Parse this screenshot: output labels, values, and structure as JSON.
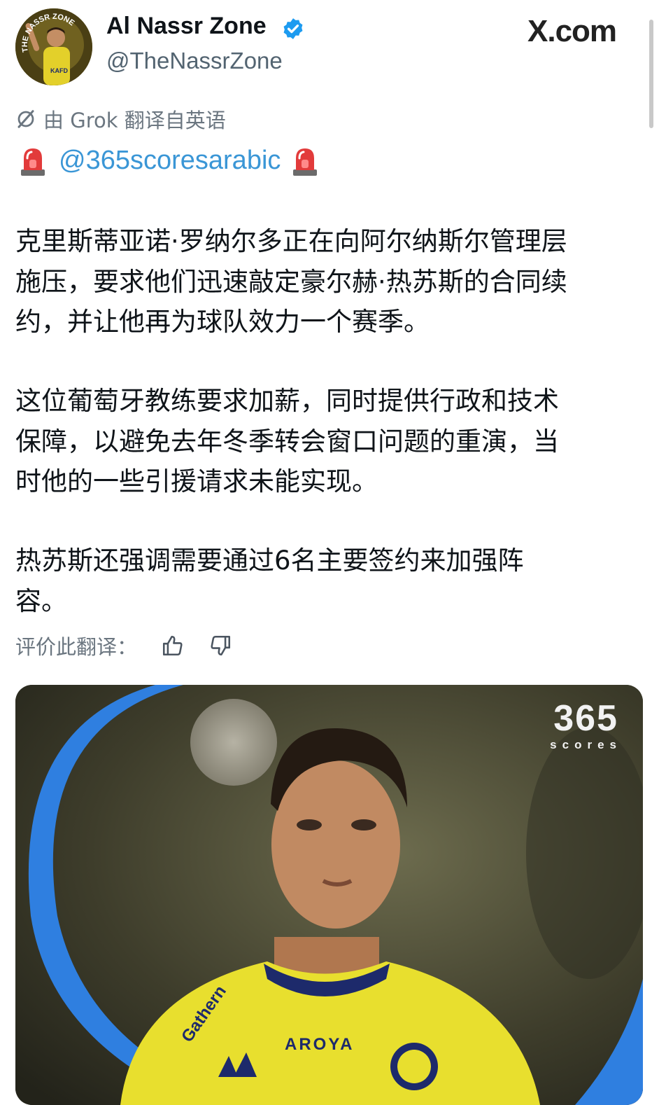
{
  "header": {
    "author_name": "Al Nassr Zone",
    "handle": "@TheNassrZone",
    "brand": "X.com",
    "verified": true
  },
  "avatar": {
    "text": "THE NASSR ZONE"
  },
  "translation_notice": "由 Grok 翻译自英语",
  "mention_line": {
    "mention": "@365scoresarabic",
    "emoji_left": "rotating-light-icon",
    "emoji_right": "rotating-light-icon"
  },
  "post": {
    "paragraphs": [
      {
        "lines": [
          "克里斯蒂亚诺·罗纳尔多正在向阿尔纳斯尔管理层",
          "施压，要求他们迅速敲定豪尔赫·热苏斯的合同续",
          "约，并让他再为球队效力一个赛季。"
        ]
      },
      {
        "lines": [
          "这位葡萄牙教练要求加薪，同时提供行政和技术",
          "保障，以避免去年冬季转会窗口问题的重演，当",
          "时他的一些引援请求未能实现。"
        ]
      },
      {
        "lines": [
          "热苏斯还强调需要通过6名主要签约来加强阵",
          "容。"
        ]
      }
    ]
  },
  "rate_translation": {
    "label": "评价此翻译：",
    "thumbs_up": "thumbs-up-icon",
    "thumbs_down": "thumbs-down-icon"
  },
  "media": {
    "logo_number": "365",
    "logo_word": "scores",
    "jersey_sponsor": "AROYA",
    "jersey_brand": "Gathern"
  },
  "colors": {
    "text": "#0f1419",
    "muted": "#6b7680",
    "link": "#3a96d6",
    "verified": "#1d9bf0",
    "jersey_yellow": "#e8df2e",
    "arc_blue": "#2f7fe0"
  }
}
